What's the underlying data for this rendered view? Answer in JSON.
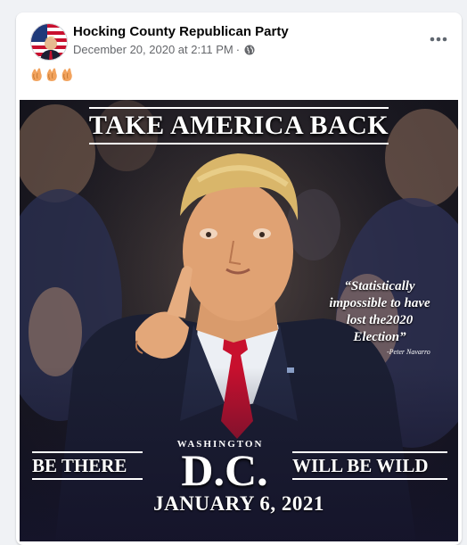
{
  "post": {
    "page_name": "Hocking County Republican Party",
    "timestamp": "December 20, 2020 at 2:11 PM",
    "separator": "·",
    "audience_icon": "globe-icon",
    "more_icon": "more-options-icon",
    "text_emojis": [
      "clapping-hands-emoji",
      "clapping-hands-emoji",
      "clapping-hands-emoji"
    ]
  },
  "poster": {
    "headline": "TAKE AMERICA BACK",
    "quote": "“Statistically impossible to have lost the2020 Election”",
    "quote_author": "-Peter Navarro",
    "left_text": "BE THERE",
    "place_small": "WASHINGTON",
    "place_big": "D.C.",
    "right_text": "WILL BE WILD",
    "date": "JANUARY 6, 2021"
  },
  "colors": {
    "background": "#f0f2f5",
    "card": "#ffffff",
    "name_text": "#050505",
    "meta_text": "#65676b",
    "tie_red": "#c8102e",
    "suit_navy": "#1b1f33"
  }
}
